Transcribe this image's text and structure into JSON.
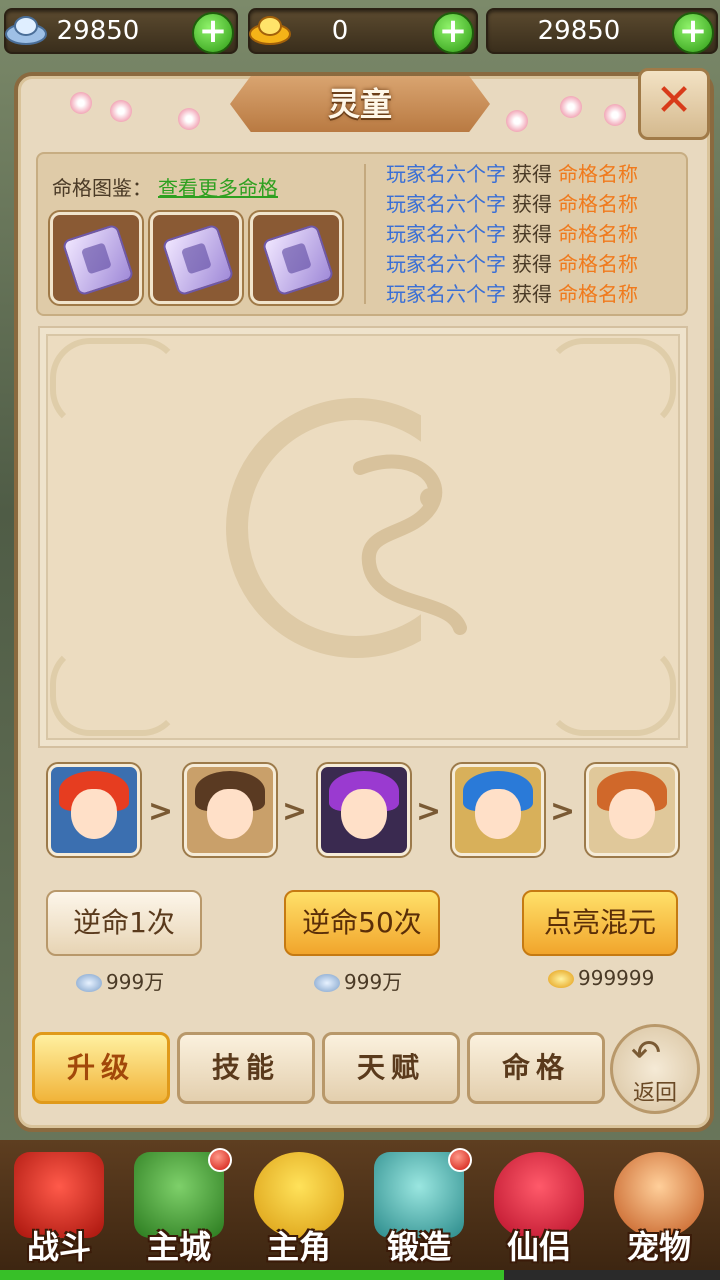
{
  "currency": [
    {
      "icon": "silver-ingot-icon",
      "value": "29850"
    },
    {
      "icon": "gold-ingot-icon",
      "value": "0"
    },
    {
      "icon": "",
      "value": "29850"
    }
  ],
  "panel": {
    "title": "灵童",
    "close_icon": "close-icon"
  },
  "codex": {
    "label": "命格图鉴：",
    "link": "查看更多命格"
  },
  "log": [
    {
      "player": "玩家名六个字",
      "verb": "获得",
      "item": "命格名称"
    },
    {
      "player": "玩家名六个字",
      "verb": "获得",
      "item": "命格名称"
    },
    {
      "player": "玩家名六个字",
      "verb": "获得",
      "item": "命格名称"
    },
    {
      "player": "玩家名六个字",
      "verb": "获得",
      "item": "命格名称"
    },
    {
      "player": "玩家名六个字",
      "verb": "获得",
      "item": "命格名称"
    }
  ],
  "heroes": [
    "red-hair-boy",
    "brown-hair-boy",
    "purple-hair-girl",
    "blue-hair-warrior",
    "orange-hair-girl"
  ],
  "actions": [
    {
      "label": "逆命1次",
      "cost": "999万",
      "currency": "silver"
    },
    {
      "label": "逆命50次",
      "cost": "999万",
      "currency": "silver"
    },
    {
      "label": "点亮混元",
      "cost": "999999",
      "currency": "gold"
    }
  ],
  "tabs": [
    "升级",
    "技能",
    "天赋",
    "命格"
  ],
  "back_label": "返回",
  "nav": [
    {
      "label": "战斗",
      "badge": false
    },
    {
      "label": "主城",
      "badge": true
    },
    {
      "label": "主角",
      "badge": false
    },
    {
      "label": "锻造",
      "badge": true
    },
    {
      "label": "仙侣",
      "badge": false
    },
    {
      "label": "宠物",
      "badge": false
    }
  ],
  "colors": {
    "player": "#3a6fd6",
    "item": "#f07a1c",
    "link": "#2ea020"
  },
  "progress": 0.7
}
